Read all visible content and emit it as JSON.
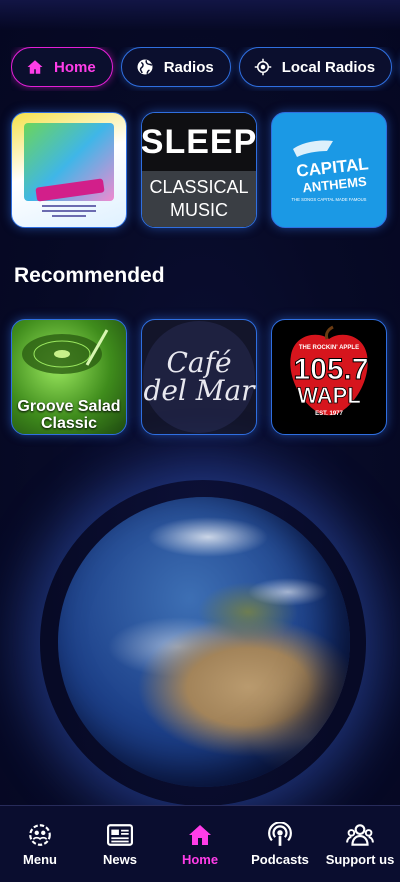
{
  "chips": [
    {
      "label": "Home",
      "icon": "home-icon",
      "active": true
    },
    {
      "label": "Radios",
      "icon": "globe-icon",
      "active": false
    },
    {
      "label": "Local Radios",
      "icon": "location-target-icon",
      "active": false
    },
    {
      "label": "",
      "icon": "trending-icon",
      "active": false
    }
  ],
  "top_row": [
    {
      "name": "Frasca station artwork",
      "poster_title": "Frascattuemmo",
      "date_line": "VENERDÌ 31 LUGLIO"
    },
    {
      "line1": "SLEEP",
      "line2": "CLASSICAL",
      "line3": "MUSIC"
    },
    {
      "brand": "CAPITAL",
      "sub": "ANTHEMS",
      "tagline": "THE SONGS CAPITAL MADE FAMOUS"
    }
  ],
  "recommended": {
    "title": "Recommended",
    "items": [
      {
        "label": "Groove Salad Classic"
      },
      {
        "logo_text": "Café del Mar"
      },
      {
        "top": "THE ROCKIN' APPLE",
        "freq": "105.7",
        "call": "WAPL",
        "est": "EST. 1977"
      }
    ]
  },
  "nav": [
    {
      "label": "Menu",
      "icon": "people-cog-icon",
      "active": false
    },
    {
      "label": "News",
      "icon": "news-icon",
      "active": false
    },
    {
      "label": "Home",
      "icon": "home-icon",
      "active": true
    },
    {
      "label": "Podcasts",
      "icon": "podcast-icon",
      "active": false
    },
    {
      "label": "Support us",
      "icon": "support-group-icon",
      "active": false
    }
  ],
  "colors": {
    "accent": "#ff3de8",
    "outline": "#2f6fe0",
    "background": "#070a26"
  }
}
